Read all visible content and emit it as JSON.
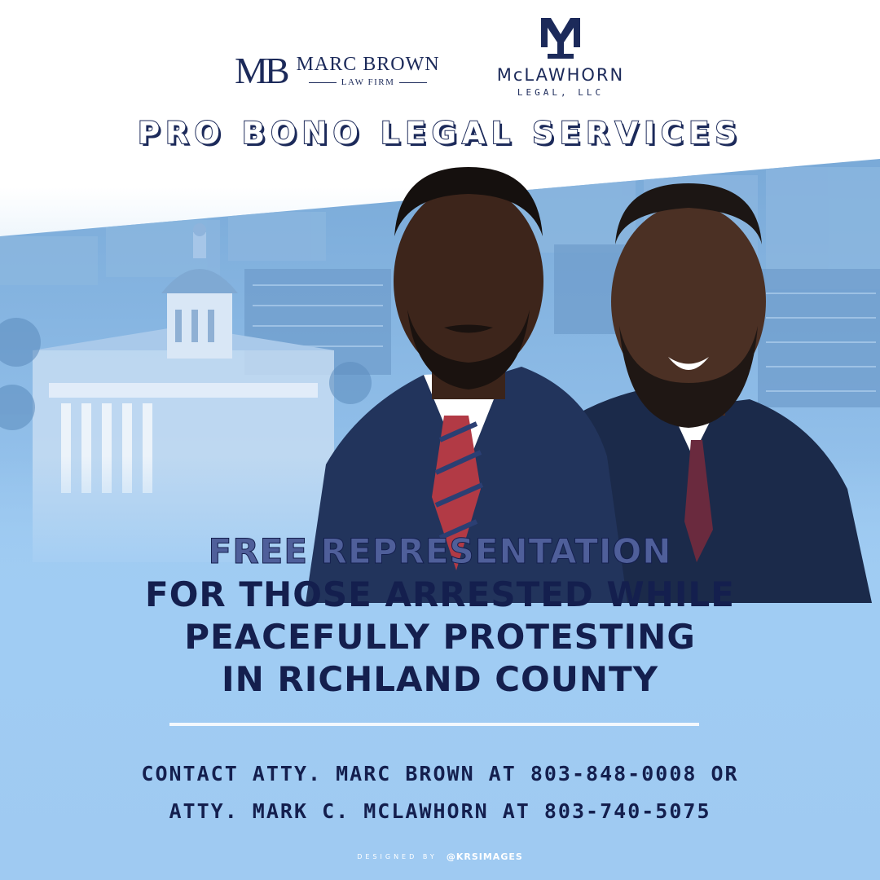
{
  "logos": {
    "marc_brown": {
      "monogram": "MB",
      "name": "MARC BROWN",
      "subtitle": "LAW FIRM"
    },
    "mclawhorn": {
      "monogram": "ML",
      "name": "McLAWHORN",
      "subtitle": "LEGAL, LLC"
    }
  },
  "headline_top": "PRO BONO LEGAL SERVICES",
  "headline_main": {
    "line1": "FREE REPRESENTATION",
    "line2": "FOR THOSE ARRESTED WHILE",
    "line3": "PEACEFULLY PROTESTING",
    "line4": "IN RICHLAND COUNTY"
  },
  "contact": {
    "line1": "CONTACT ATTY. MARC BROWN AT 803-848-0008 OR",
    "line2": "ATTY. MARK C. MCLAWHORN AT 803-740-5075"
  },
  "credit": {
    "prefix": "DESIGNED BY",
    "handle": "@KRSIMAGES"
  },
  "colors": {
    "navy": "#1c2a5a",
    "sky_blue": "#9ccbf3",
    "photo_blue": "#7aaad8"
  }
}
